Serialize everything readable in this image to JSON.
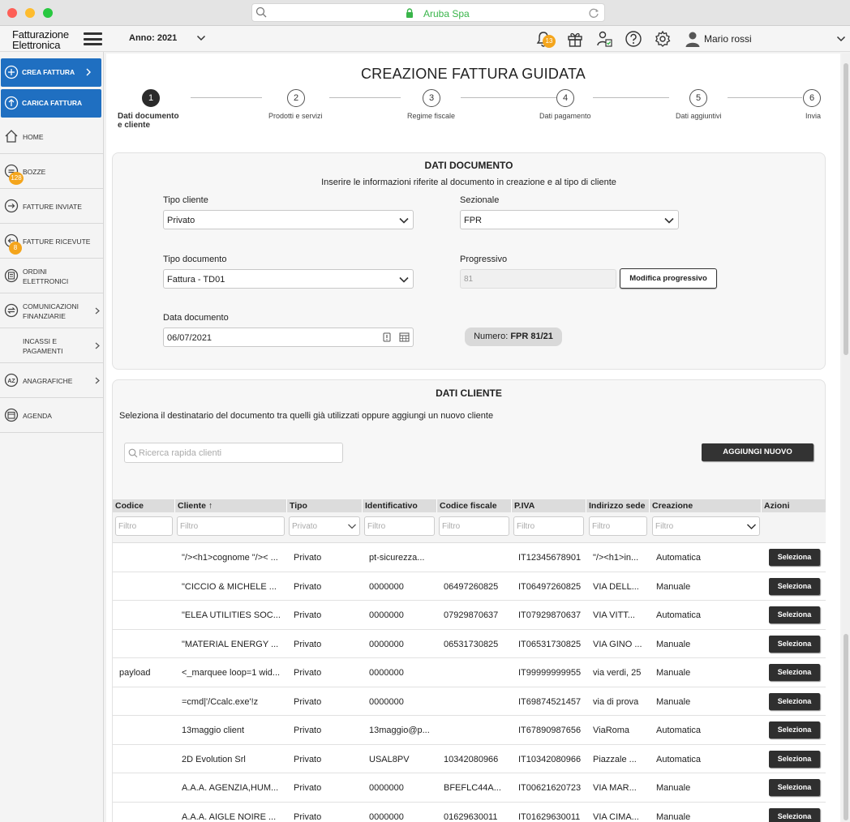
{
  "browser": {
    "url_text": "Aruba Spa"
  },
  "header": {
    "logo_line1": "Fatturazione",
    "logo_line2": "Elettronica",
    "anno_label": "Anno: 2021",
    "notifications_count": "13",
    "user_name": "Mario rossi"
  },
  "sidebar": {
    "crea_fattura": "CREA FATTURA",
    "carica_fattura": "CARICA FATTURA",
    "items": [
      {
        "label": "HOME"
      },
      {
        "label": "BOZZE",
        "badge": "128"
      },
      {
        "label": "FATTURE INVIATE"
      },
      {
        "label": "FATTURE RICEVUTE",
        "badge": "8"
      },
      {
        "label_l1": "ORDINI",
        "label_l2": "ELETTRONICI"
      },
      {
        "label_l1": "COMUNICAZIONI",
        "label_l2": "FINANZIARIE"
      },
      {
        "label_l1": "INCASSI E",
        "label_l2": "PAGAMENTI"
      },
      {
        "label": "ANAGRAFICHE"
      },
      {
        "label": "AGENDA"
      }
    ]
  },
  "page": {
    "title": "CREAZIONE FATTURA GUIDATA",
    "steps": [
      {
        "num": "1",
        "label_l1": "Dati documento",
        "label_l2": "e cliente"
      },
      {
        "num": "2",
        "label": "Prodotti e servizi"
      },
      {
        "num": "3",
        "label": "Regime fiscale"
      },
      {
        "num": "4",
        "label": "Dati pagamento"
      },
      {
        "num": "5",
        "label": "Dati aggiuntivi"
      },
      {
        "num": "6",
        "label": "Invia"
      }
    ]
  },
  "documento": {
    "title": "DATI DOCUMENTO",
    "subtitle": "Inserire le informazioni riferite al documento in creazione e al tipo di cliente",
    "tipo_cliente_label": "Tipo cliente",
    "tipo_cliente_value": "Privato",
    "sezionale_label": "Sezionale",
    "sezionale_value": "FPR",
    "tipo_documento_label": "Tipo documento",
    "tipo_documento_value": "Fattura - TD01",
    "progressivo_label": "Progressivo",
    "progressivo_value": "81",
    "modifica_button": "Modifica progressivo",
    "data_label": "Data documento",
    "data_value": "06/07/2021",
    "numero_label": "Numero:",
    "numero_value": "FPR 81/21"
  },
  "cliente": {
    "title": "DATI CLIENTE",
    "subtitle": "Seleziona il destinatario del documento tra quelli già utilizzati oppure aggiungi un nuovo cliente",
    "search_placeholder": "Ricerca rapida clienti",
    "add_button": "AGGIUNGI NUOVO"
  },
  "table": {
    "headers": [
      "Codice",
      "Cliente ↑",
      "Tipo",
      "Identificativo",
      "Codice fiscale",
      "P.IVA",
      "Indirizzo sede",
      "Creazione",
      "Azioni"
    ],
    "filter_placeholder": "Filtro",
    "tipo_filter_placeholder": "Privato",
    "select_label": "Seleziona",
    "rows": [
      [
        "",
        "\"/><h1>cognome \"/>< ...",
        "Privato",
        "pt-sicurezza...",
        "",
        "IT12345678901",
        "\"/><h1>in...",
        "Automatica"
      ],
      [
        "",
        "\"CICCIO & MICHELE ...",
        "Privato",
        "0000000",
        "06497260825",
        "IT06497260825",
        "VIA DELL...",
        "Manuale"
      ],
      [
        "",
        "\"ELEA UTILITIES SOC...",
        "Privato",
        "0000000",
        "07929870637",
        "IT07929870637",
        "VIA VITT...",
        "Automatica"
      ],
      [
        "",
        "\"MATERIAL ENERGY ...",
        "Privato",
        "0000000",
        "06531730825",
        "IT06531730825",
        "VIA GINO ...",
        "Manuale"
      ],
      [
        "payload",
        "<_marquee loop=1 wid...",
        "Privato",
        "0000000",
        "",
        "IT99999999955",
        "via verdi, 25",
        "Manuale"
      ],
      [
        "",
        "=cmd|'/Ccalc.exe'!z",
        "Privato",
        "0000000",
        "",
        "IT69874521457",
        "via di prova",
        "Manuale"
      ],
      [
        "",
        "13maggio client",
        "Privato",
        "13maggio@p...",
        "",
        "IT67890987656",
        "ViaRoma",
        "Automatica"
      ],
      [
        "",
        "2D Evolution Srl",
        "Privato",
        "USAL8PV",
        "10342080966",
        "IT10342080966",
        "Piazzale ...",
        "Automatica"
      ],
      [
        "",
        "A.A.A. AGENZIA,HUM...",
        "Privato",
        "0000000",
        "BFEFLC44A...",
        "IT00621620723",
        "VIA MAR...",
        "Manuale"
      ],
      [
        "",
        "A.A.A. AIGLE NOIRE ...",
        "Privato",
        "0000000",
        "01629630011",
        "IT01629630011",
        "VIA CIMA...",
        "Manuale"
      ]
    ]
  }
}
